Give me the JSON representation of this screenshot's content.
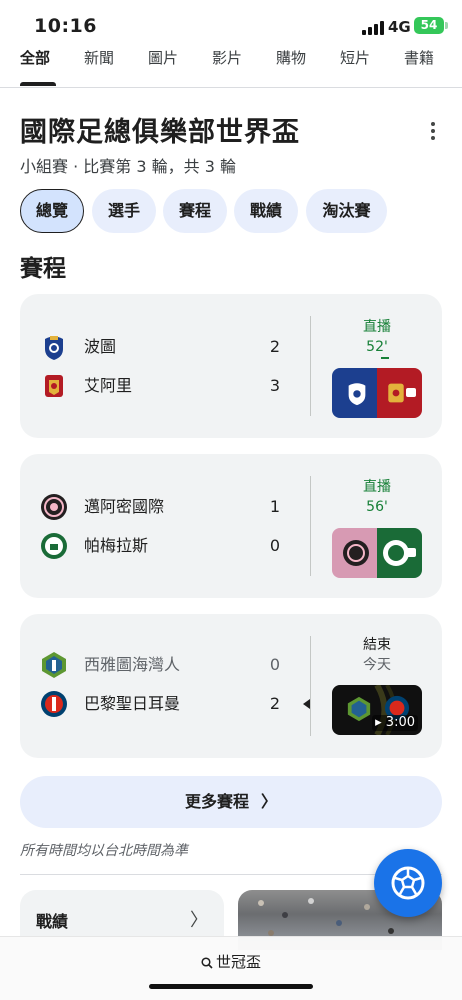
{
  "status_bar": {
    "time": "10:16",
    "network": "4G",
    "battery": "54"
  },
  "top_tabs": [
    "全部",
    "新聞",
    "圖片",
    "影片",
    "購物",
    "短片",
    "書籍"
  ],
  "header": {
    "title": "國際足總俱樂部世界盃",
    "subtitle": "小組賽 · 比賽第 3 輪，共 3 輪"
  },
  "chips": [
    "總覽",
    "選手",
    "賽程",
    "戰績",
    "淘汰賽"
  ],
  "section_title": "賽程",
  "matches": [
    {
      "home": {
        "name": "波圖",
        "score": "2",
        "icon": "fc-porto-crest-icon"
      },
      "away": {
        "name": "艾阿里",
        "score": "3",
        "icon": "al-ahly-crest-icon"
      },
      "status": "直播",
      "minute": "52'",
      "thumb_colors": [
        "#1c3f8f",
        "#b31b24"
      ]
    },
    {
      "home": {
        "name": "邁阿密國際",
        "score": "1",
        "icon": "inter-miami-crest-icon"
      },
      "away": {
        "name": "帕梅拉斯",
        "score": "0",
        "icon": "palmeiras-crest-icon"
      },
      "status": "直播",
      "minute": "56'",
      "thumb_colors": [
        "#e0a8bd",
        "#1a6b37"
      ]
    },
    {
      "home": {
        "name": "西雅圖海灣人",
        "score": "0",
        "icon": "seattle-sounders-crest-icon"
      },
      "away": {
        "name": "巴黎聖日耳曼",
        "score": "2",
        "icon": "psg-crest-icon"
      },
      "status": "結束",
      "minute": "今天",
      "duration": "3:00",
      "thumb_colors": [
        "#101010",
        "#101010"
      ]
    }
  ],
  "more_button": "更多賽程",
  "footnote": "所有時間均以台北時間為準",
  "standings_card": "戰績",
  "bottom_search": "世冠盃",
  "colors": {
    "accent": "#1a73e8",
    "chip_bg": "#e8eefc",
    "live_green": "#188038",
    "card_bg": "#f1f3f4"
  }
}
